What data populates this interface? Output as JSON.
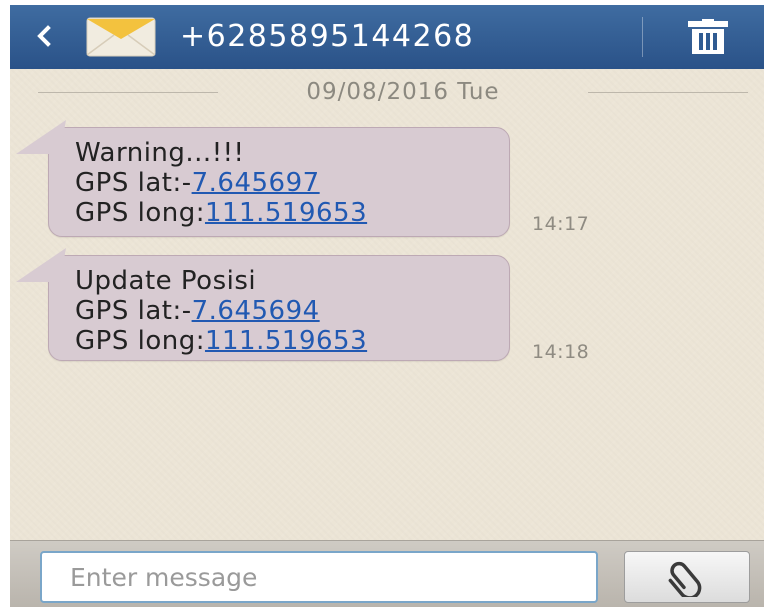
{
  "header": {
    "back_icon": "chevron-left-icon",
    "contact_icon": "envelope-icon",
    "contact": "+6285895144268",
    "delete_icon": "trash-icon"
  },
  "conversation": {
    "date": "09/08/2016 Tue",
    "messages": [
      {
        "title": "Warning...!!!",
        "lat_label": "GPS lat:-",
        "lat_value": "7.645697",
        "long_label": "GPS long:",
        "long_value": "111.519653",
        "time": "14:17"
      },
      {
        "title": "Update Posisi",
        "lat_label": "GPS lat:-",
        "lat_value": "7.645694",
        "long_label": "GPS long:",
        "long_value": "111.519653",
        "time": "14:18"
      }
    ]
  },
  "composer": {
    "placeholder": "Enter message",
    "attach_icon": "paperclip-icon"
  },
  "colors": {
    "header": "#2f5b92",
    "background": "#ece5d6",
    "bubble": "#d8cbd2",
    "link": "#2159b2"
  }
}
